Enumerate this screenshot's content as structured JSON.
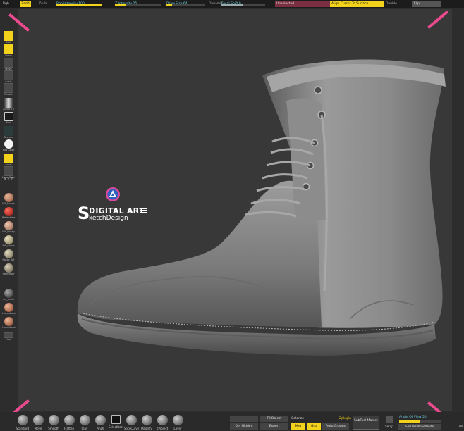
{
  "top_bar": {
    "rgb": "Rgb",
    "zadd": "Zadd",
    "zsub": "Zsub",
    "rgb_intensity": "Rgb Intensity 100",
    "z_intensity": "Z Intensity 25",
    "draw_size": "Draw Size 64",
    "dynamic": "Dynamic",
    "focal_shift": "Focal Shift 0",
    "unselected": "Unselected",
    "align_cursor": "Align Cursor To Surface",
    "double": "Double",
    "flip": "Flip"
  },
  "left_tools": [
    {
      "label": "Edit"
    },
    {
      "label": "Draw"
    },
    {
      "label": "Move"
    },
    {
      "label": "Scale"
    },
    {
      "label": "Rotate"
    },
    {
      "label": "Alpha 23"
    },
    {
      "label": "Rect"
    },
    {
      "label": "Texture"
    },
    {
      "label": "Flat Color"
    },
    {
      "label": "Local"
    },
    {
      "label": "Local Sym"
    },
    {
      "label": "X Y Z"
    },
    {
      "label": "MS_Roads"
    },
    {
      "label": "Reflectfew"
    },
    {
      "label": "MS_Rocky"
    },
    {
      "label": "MS_Stone"
    },
    {
      "label": "Rocky_AR"
    },
    {
      "label": "Reflectoff"
    },
    {
      "label": "mr_mats"
    },
    {
      "label": "Hazardous"
    },
    {
      "label": "Hazardous"
    },
    {
      "label": "Floor"
    }
  ],
  "logo": {
    "letter": "S",
    "line1": "DIGITAL ART",
    "line2": "ketchDesign"
  },
  "bottom_bar": {
    "brushes": [
      {
        "label": "Standard"
      },
      {
        "label": "Move"
      },
      {
        "label": "Smooth"
      },
      {
        "label": "Flatten"
      },
      {
        "label": "Clay"
      },
      {
        "label": "Pinch"
      },
      {
        "label": "SelectRect"
      },
      {
        "label": "SliceCurve"
      },
      {
        "label": "Magnify"
      },
      {
        "label": "ZProject"
      },
      {
        "label": "Layer"
      }
    ],
    "fill_object": "FillObject",
    "colorize": "Colorize",
    "zplugin": "Zplugin",
    "del_hidden": "Del Hidden",
    "export": "Export",
    "mrg": "Mrg",
    "grp": "Grp",
    "auto_groups": "Auto Groups",
    "subtool_master": "SubTool Master",
    "setup": "Setup",
    "angle_of_view": "Angle Of View 50",
    "set_uv": "SetUVsMoveMode",
    "zoom": "ZM"
  },
  "colors": {
    "accent": "#f2d21b",
    "corner_marker": "#ea4a8e",
    "background": "#383838"
  }
}
